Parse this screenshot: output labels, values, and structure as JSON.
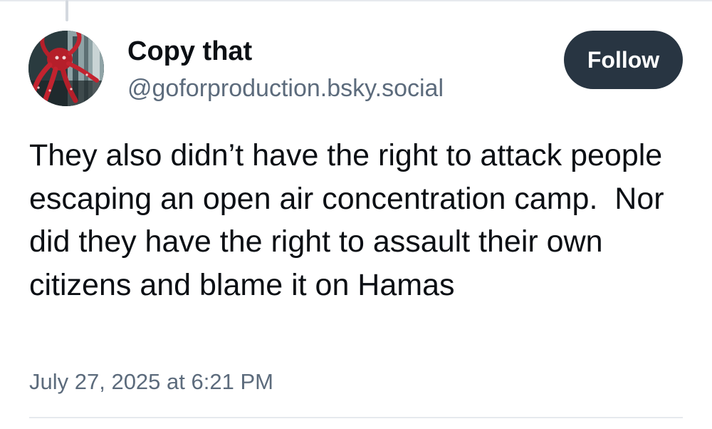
{
  "post": {
    "author": {
      "display_name": "Copy that",
      "handle": "@goforproduction.bsky.social",
      "avatar_icon": "octopus-avatar-icon"
    },
    "follow_label": "Follow",
    "text": "They also didn’t have the right to attack people escaping an open air concentration camp.  Nor did they have the right to assault their own citizens and blame it on Hamas",
    "timestamp": "July 27, 2025 at 6:21 PM"
  },
  "colors": {
    "follow_button_bg": "#283542",
    "handle_text": "#5c6b7c",
    "body_text": "#0b0f14"
  }
}
